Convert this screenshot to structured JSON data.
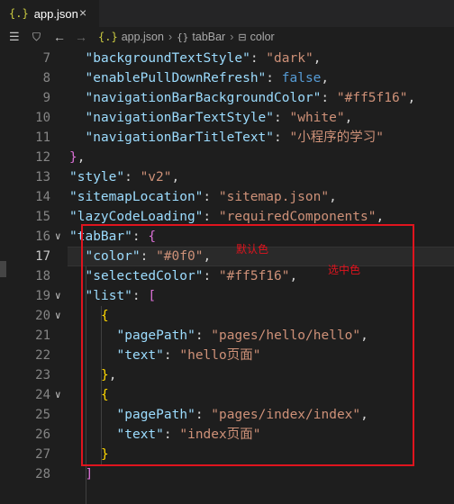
{
  "tab": {
    "icon": "{.}",
    "filename": "app.json",
    "close": "×"
  },
  "breadcrumb": {
    "file_icon": "{.}",
    "file": "app.json",
    "sep": "›",
    "obj_icon": "{}",
    "node": "tabBar",
    "prop_icon": "⊟",
    "leaf": "color"
  },
  "lines": [
    {
      "n": "7",
      "parts": [
        [
          "k",
          "\"backgroundTextStyle\""
        ],
        [
          "p",
          ": "
        ],
        [
          "s",
          "\"dark\""
        ],
        [
          "p",
          ","
        ]
      ]
    },
    {
      "n": "8",
      "parts": [
        [
          "k",
          "\"enablePullDownRefresh\""
        ],
        [
          "p",
          ": "
        ],
        [
          "b",
          "false"
        ],
        [
          "p",
          ","
        ]
      ]
    },
    {
      "n": "9",
      "parts": [
        [
          "k",
          "\"navigationBarBackgroundColor\""
        ],
        [
          "p",
          ": "
        ],
        [
          "s",
          "\"#ff5f16\""
        ],
        [
          "p",
          ","
        ]
      ]
    },
    {
      "n": "10",
      "parts": [
        [
          "k",
          "\"navigationBarTextStyle\""
        ],
        [
          "p",
          ": "
        ],
        [
          "s",
          "\"white\""
        ],
        [
          "p",
          ","
        ]
      ]
    },
    {
      "n": "11",
      "parts": [
        [
          "k",
          "\"navigationBarTitleText\""
        ],
        [
          "p",
          ": "
        ],
        [
          "s",
          "\"小程序的学习\""
        ]
      ]
    },
    {
      "n": "12",
      "parts": [
        [
          "br1",
          "}"
        ],
        [
          "p",
          ","
        ]
      ]
    },
    {
      "n": "13",
      "parts": [
        [
          "k",
          "\"style\""
        ],
        [
          "p",
          ": "
        ],
        [
          "s",
          "\"v2\""
        ],
        [
          "p",
          ","
        ]
      ]
    },
    {
      "n": "14",
      "parts": [
        [
          "k",
          "\"sitemapLocation\""
        ],
        [
          "p",
          ": "
        ],
        [
          "s",
          "\"sitemap.json\""
        ],
        [
          "p",
          ","
        ]
      ]
    },
    {
      "n": "15",
      "parts": [
        [
          "k",
          "\"lazyCodeLoading\""
        ],
        [
          "p",
          ": "
        ],
        [
          "s",
          "\"requiredComponents\""
        ],
        [
          "p",
          ","
        ]
      ]
    },
    {
      "n": "16",
      "parts": [
        [
          "k",
          "\"tabBar\""
        ],
        [
          "p",
          ": "
        ],
        [
          "br1",
          "{"
        ]
      ]
    },
    {
      "n": "17",
      "parts": [
        [
          "k",
          "\"color\""
        ],
        [
          "p",
          ": "
        ],
        [
          "s",
          "\"#0f0\""
        ],
        [
          "p",
          ","
        ]
      ]
    },
    {
      "n": "18",
      "parts": [
        [
          "k",
          "\"selectedColor\""
        ],
        [
          "p",
          ": "
        ],
        [
          "s",
          "\"#ff5f16\""
        ],
        [
          "p",
          ","
        ]
      ]
    },
    {
      "n": "19",
      "parts": [
        [
          "k",
          "\"list\""
        ],
        [
          "p",
          ": "
        ],
        [
          "br1",
          "["
        ]
      ]
    },
    {
      "n": "20",
      "parts": [
        [
          "br2",
          "{"
        ]
      ]
    },
    {
      "n": "21",
      "parts": [
        [
          "k",
          "\"pagePath\""
        ],
        [
          "p",
          ": "
        ],
        [
          "s",
          "\"pages/hello/hello\""
        ],
        [
          "p",
          ","
        ]
      ]
    },
    {
      "n": "22",
      "parts": [
        [
          "k",
          "\"text\""
        ],
        [
          "p",
          ": "
        ],
        [
          "s",
          "\"hello页面\""
        ]
      ]
    },
    {
      "n": "23",
      "parts": [
        [
          "br2",
          "}"
        ],
        [
          "p",
          ","
        ]
      ]
    },
    {
      "n": "24",
      "parts": [
        [
          "br2",
          "{"
        ]
      ]
    },
    {
      "n": "25",
      "parts": [
        [
          "k",
          "\"pagePath\""
        ],
        [
          "p",
          ": "
        ],
        [
          "s",
          "\"pages/index/index\""
        ],
        [
          "p",
          ","
        ]
      ]
    },
    {
      "n": "26",
      "parts": [
        [
          "k",
          "\"text\""
        ],
        [
          "p",
          ": "
        ],
        [
          "s",
          "\"index页面\""
        ]
      ]
    },
    {
      "n": "27",
      "parts": [
        [
          "br2",
          "}"
        ]
      ]
    },
    {
      "n": "28",
      "parts": [
        [
          "br1",
          "]"
        ]
      ]
    }
  ],
  "annotations": {
    "default_color": "默认色",
    "selected_color": "选中色"
  },
  "colors": {
    "annotation_red": "#e0141e"
  }
}
